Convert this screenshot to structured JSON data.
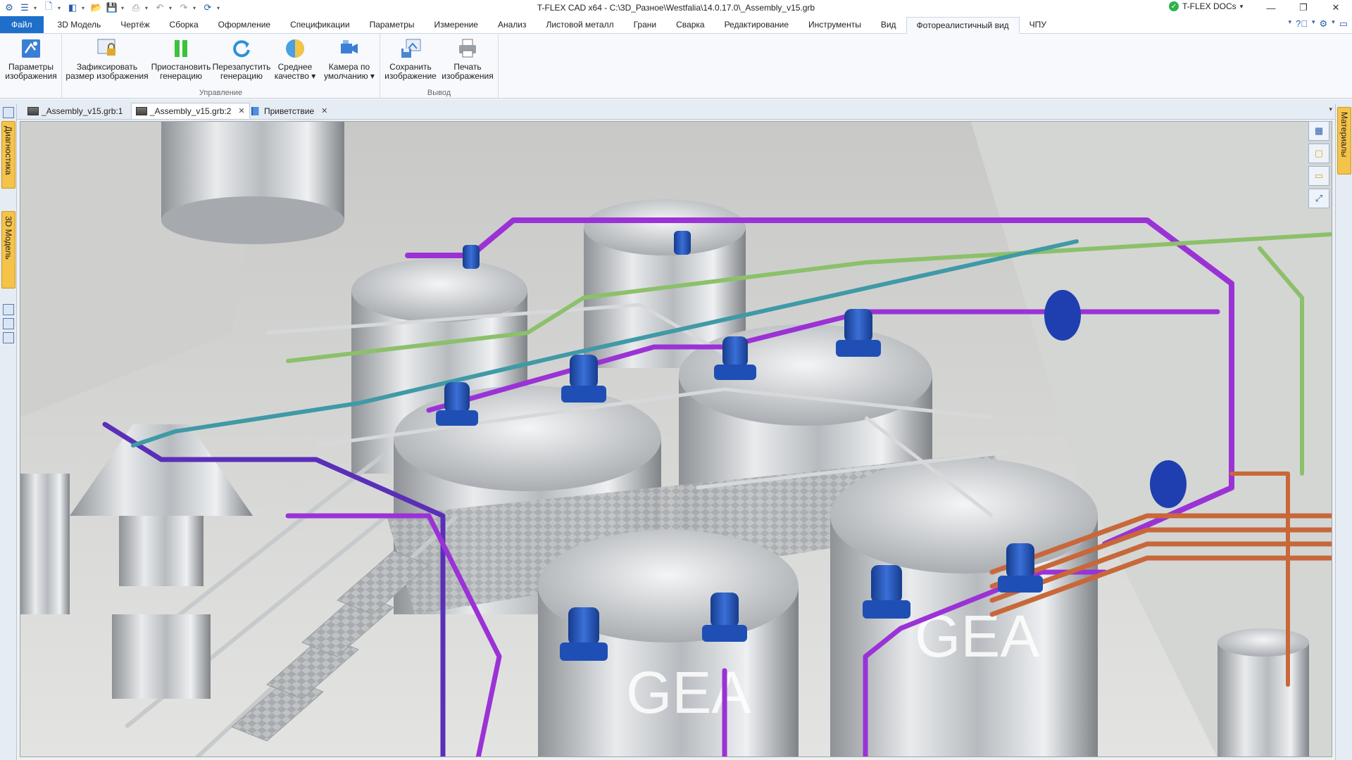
{
  "window": {
    "title": "T-FLEX CAD x64 - C:\\3D_Разное\\Westfalia\\14.0.17.0\\_Assembly_v15.grb",
    "docs_label": "T-FLEX DOCs",
    "controls": [
      "—",
      "❐",
      "✕"
    ]
  },
  "menu": {
    "file": "Файл",
    "tabs": [
      "3D Модель",
      "Чертёж",
      "Сборка",
      "Оформление",
      "Спецификации",
      "Параметры",
      "Измерение",
      "Анализ",
      "Листовой металл",
      "Грани",
      "Сварка",
      "Редактирование",
      "Инструменты",
      "Вид",
      "Фотореалистичный вид",
      "ЧПУ"
    ],
    "active_tab": "Фотореалистичный вид"
  },
  "ribbon": {
    "params_btn": [
      "Параметры",
      "изображения"
    ],
    "fix_btn": [
      "Зафиксировать",
      "размер изображения"
    ],
    "pause_btn": [
      "Приостановить",
      "генерацию"
    ],
    "restart_btn": [
      "Перезапустить",
      "генерацию"
    ],
    "quality_btn": [
      "Среднее",
      "качество ▾"
    ],
    "camera_btn": [
      "Камера по",
      "умолчанию ▾"
    ],
    "save_btn": [
      "Сохранить",
      "изображение"
    ],
    "print_btn": [
      "Печать",
      "изображения"
    ],
    "group_control": "Управление",
    "group_output": "Вывод"
  },
  "doc_tabs": [
    {
      "label": "_Assembly_v15.grb:1",
      "close": "✕"
    },
    {
      "label": "_Assembly_v15.grb:2",
      "close": "✕"
    },
    {
      "label": "Приветствие",
      "close": "✕"
    }
  ],
  "side_panels": {
    "left": [
      "Диагностика",
      "3D Модель"
    ],
    "right": "Материалы"
  },
  "scene": {
    "logo_left": "GEA",
    "logo_right": "GEA",
    "colors": {
      "pipe_purple": "#9b32d6",
      "pipe_violet": "#5a2fb8",
      "pipe_green": "#8cc06a",
      "pipe_teal": "#3f9aa6",
      "pipe_copper": "#c8683a",
      "motor_blue": "#1f4fb5",
      "steel": "#c9ccd0"
    }
  }
}
